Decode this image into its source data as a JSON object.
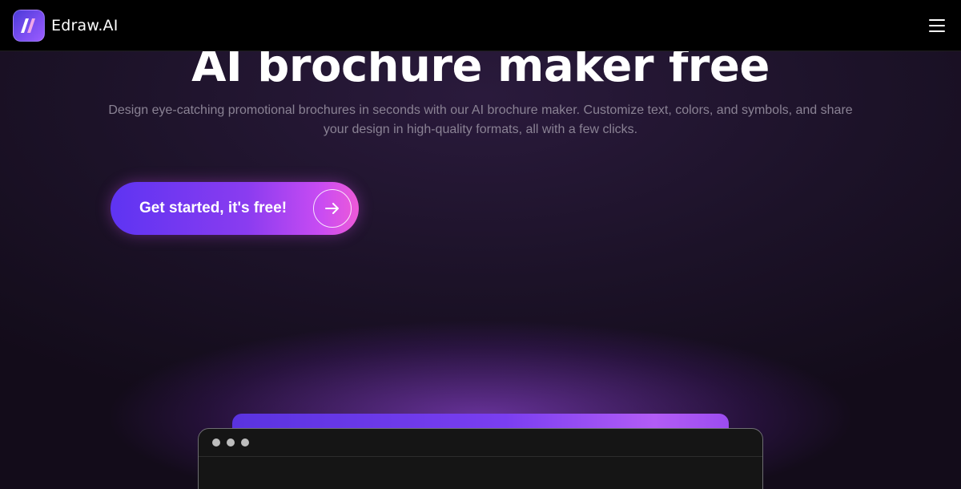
{
  "header": {
    "brand": "Edraw.AI",
    "logo_icon": "edraw-logo-icon",
    "menu_icon": "hamburger-menu-icon"
  },
  "hero": {
    "title": "AI brochure maker free",
    "subtitle": "Design eye-catching promotional brochures in seconds with our AI brochure maker. Customize text, colors, and symbols, and share your design in high-quality formats, all with a few clicks."
  },
  "cta": {
    "label": "Get started, it's free!",
    "icon": "arrow-right-icon"
  },
  "preview": {
    "window_dots": [
      "dot-1",
      "dot-2",
      "dot-3"
    ]
  },
  "colors": {
    "header_bg": "#000000",
    "page_bg": "#1c1228",
    "cta_start": "#5e34f2",
    "cta_end": "#ee5ad8",
    "subtitle_text": "#8a8294"
  }
}
